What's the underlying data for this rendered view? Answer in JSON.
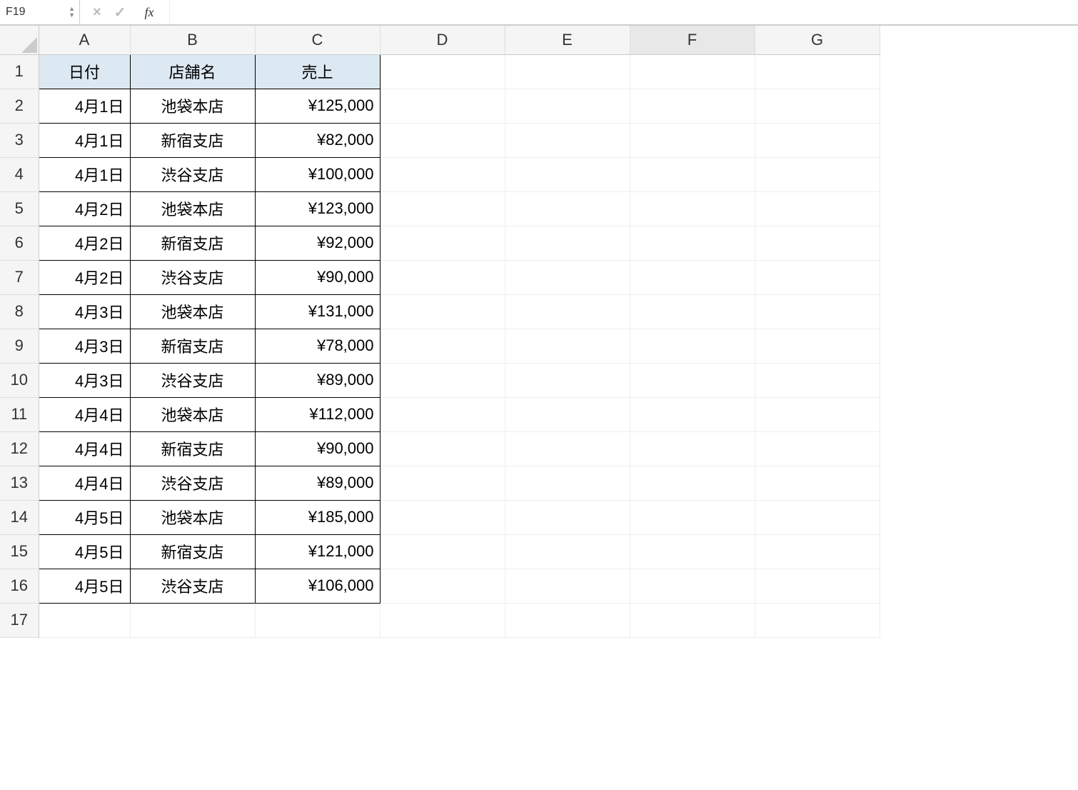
{
  "formula_bar": {
    "name_box": "F19",
    "cancel_symbol": "×",
    "accept_symbol": "✓",
    "fx_label": "fx",
    "formula_value": ""
  },
  "columns": [
    "A",
    "B",
    "C",
    "D",
    "E",
    "F",
    "G"
  ],
  "selected_column": "F",
  "row_numbers": [
    "1",
    "2",
    "3",
    "4",
    "5",
    "6",
    "7",
    "8",
    "9",
    "10",
    "11",
    "12",
    "13",
    "14",
    "15",
    "16",
    "17"
  ],
  "headers": {
    "A": "日付",
    "B": "店舗名",
    "C": "売上"
  },
  "rows": [
    {
      "A": "4月1日",
      "B": "池袋本店",
      "C": "¥125,000"
    },
    {
      "A": "4月1日",
      "B": "新宿支店",
      "C": "¥82,000"
    },
    {
      "A": "4月1日",
      "B": "渋谷支店",
      "C": "¥100,000"
    },
    {
      "A": "4月2日",
      "B": "池袋本店",
      "C": "¥123,000"
    },
    {
      "A": "4月2日",
      "B": "新宿支店",
      "C": "¥92,000"
    },
    {
      "A": "4月2日",
      "B": "渋谷支店",
      "C": "¥90,000"
    },
    {
      "A": "4月3日",
      "B": "池袋本店",
      "C": "¥131,000"
    },
    {
      "A": "4月3日",
      "B": "新宿支店",
      "C": "¥78,000"
    },
    {
      "A": "4月3日",
      "B": "渋谷支店",
      "C": "¥89,000"
    },
    {
      "A": "4月4日",
      "B": "池袋本店",
      "C": "¥112,000"
    },
    {
      "A": "4月4日",
      "B": "新宿支店",
      "C": "¥90,000"
    },
    {
      "A": "4月4日",
      "B": "渋谷支店",
      "C": "¥89,000"
    },
    {
      "A": "4月5日",
      "B": "池袋本店",
      "C": "¥185,000"
    },
    {
      "A": "4月5日",
      "B": "新宿支店",
      "C": "¥121,000"
    },
    {
      "A": "4月5日",
      "B": "渋谷支店",
      "C": "¥106,000"
    }
  ]
}
